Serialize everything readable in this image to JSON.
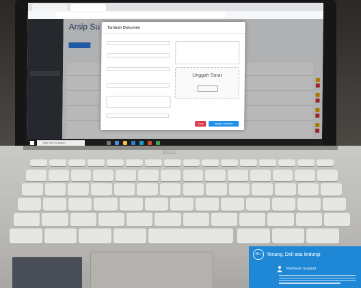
{
  "browser": {
    "tabs": [
      "...",
      "..."
    ],
    "url": ""
  },
  "app": {
    "page_title": "Arsip Su",
    "sidebar_items": [
      "",
      "",
      "",
      "",
      "",
      "",
      ""
    ],
    "add_button": ""
  },
  "modal": {
    "title": "Tambah Dokumen",
    "labels": [
      "",
      "",
      "",
      "",
      "",
      "",
      ""
    ],
    "fields": [
      "",
      "",
      "",
      "",
      ""
    ],
    "upload_title": "Unggah Surat",
    "upload_button": "",
    "close_button": "Close",
    "save_button": "Simpan Dokumen"
  },
  "taskbar": {
    "search_placeholder": "Type here to search",
    "tray_text": "",
    "date": ""
  },
  "laptop": {
    "brand": "DELL"
  },
  "sticker": {
    "title": "Tenang, Dell ada lindungi",
    "subtitle": "Premium Support",
    "brand": "DELL",
    "left_text": ""
  },
  "colors": {
    "sidebar": "#343a40",
    "primary_button": "#1e90e8",
    "close_button": "#dc3545",
    "dell_card": "#1e88d6"
  }
}
